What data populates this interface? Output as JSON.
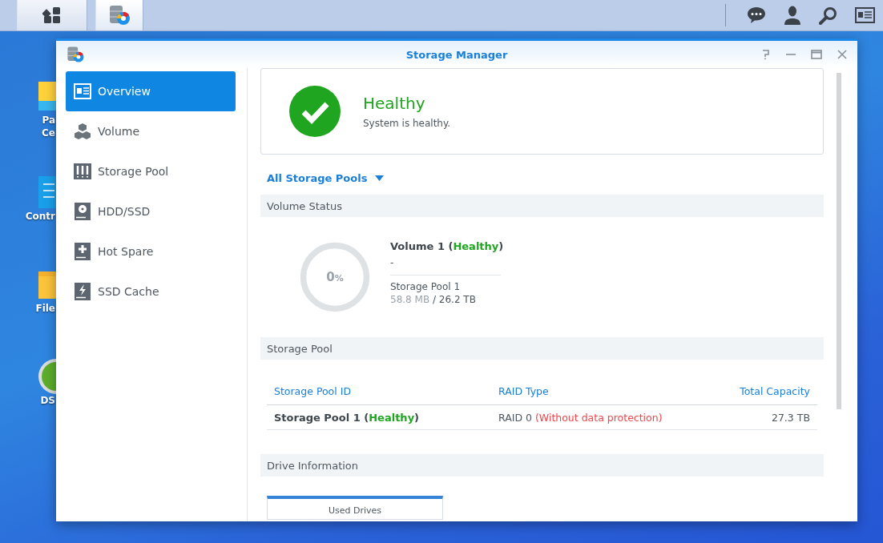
{
  "taskbar": {
    "left_buttons": [
      {
        "kind": "menu",
        "selected": false
      },
      {
        "kind": "storage",
        "selected": true
      }
    ]
  },
  "desktop_icons": [
    {
      "kind": "package",
      "lines": [
        "Pa",
        "Ce"
      ]
    },
    {
      "kind": "control",
      "lines": [
        "Contr"
      ]
    },
    {
      "kind": "folder",
      "lines": [
        "File"
      ]
    },
    {
      "kind": "dsm",
      "lines": [
        "DS"
      ]
    }
  ],
  "window": {
    "title": "Storage Manager"
  },
  "sidebar": {
    "items": [
      {
        "label": "Overview",
        "selected": true
      },
      {
        "label": "Volume",
        "selected": false
      },
      {
        "label": "Storage Pool",
        "selected": false
      },
      {
        "label": "HDD/SSD",
        "selected": false
      },
      {
        "label": "Hot Spare",
        "selected": false
      },
      {
        "label": "SSD Cache",
        "selected": false
      }
    ]
  },
  "health": {
    "title": "Healthy",
    "message": "System is healthy."
  },
  "filter": {
    "label": "All Storage Pools"
  },
  "volume_status": {
    "heading": "Volume Status",
    "gauge": {
      "level": 0,
      "value": "0",
      "unit": "%"
    },
    "volume": {
      "name": "Volume 1 (",
      "status": "Healthy",
      "close": ")",
      "description": "-",
      "pool": "Storage Pool 1",
      "used": "58.8 MB",
      "total": "/ 26.2 TB"
    }
  },
  "storage_pool": {
    "heading": "Storage Pool",
    "columns": [
      "Storage Pool ID",
      "RAID Type",
      "Total Capacity"
    ],
    "rows": [
      {
        "name": "Storage Pool 1 (",
        "status": "Healthy",
        "close": ")",
        "raid": "RAID 0",
        "raid_note": "(Without data protection)",
        "capacity": "27.3 TB"
      }
    ]
  },
  "drive_information": {
    "heading": "Drive Information",
    "tabs": [
      {
        "label": "Used Drives",
        "selected": true
      }
    ]
  }
}
